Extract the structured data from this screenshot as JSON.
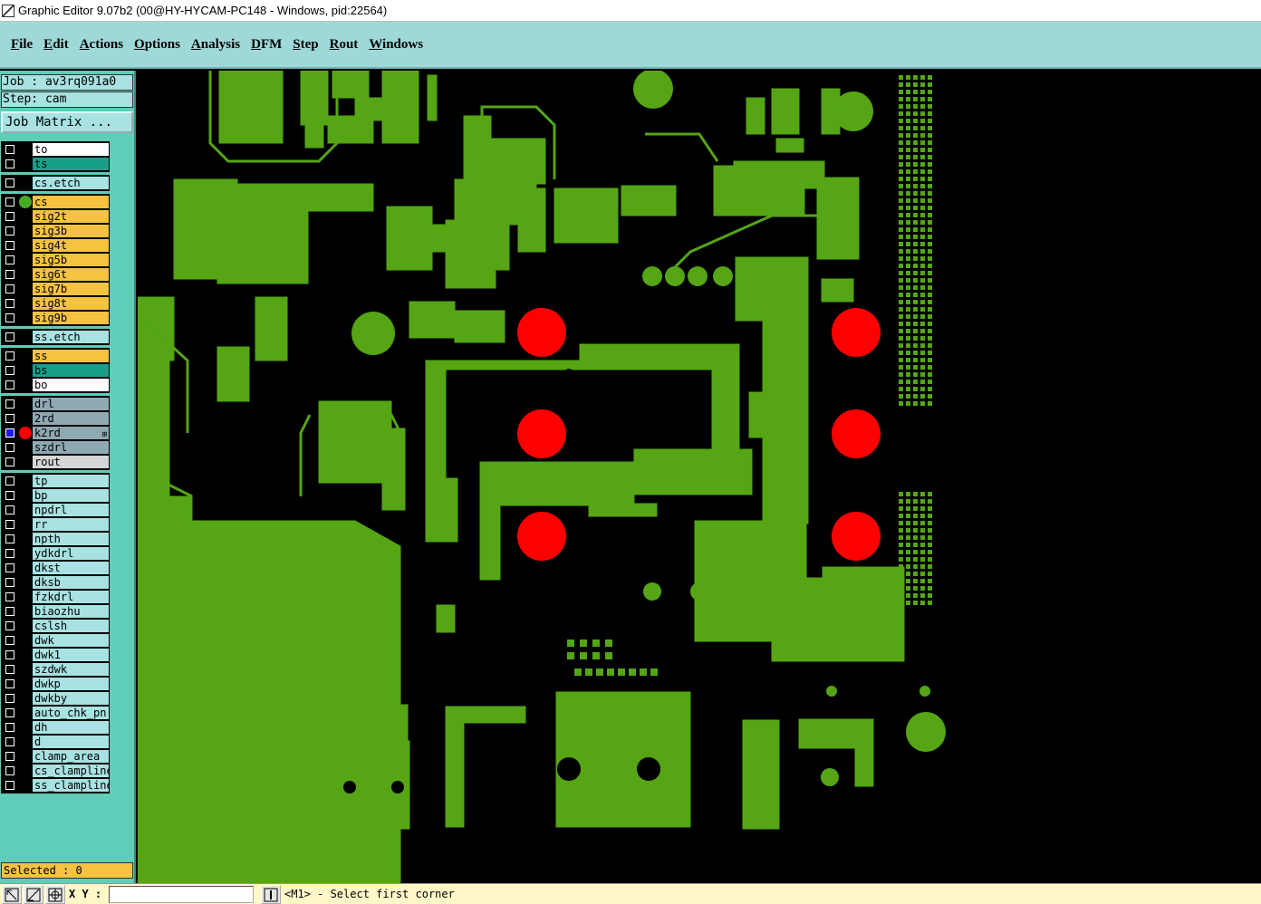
{
  "window": {
    "title": "Graphic Editor 9.07b2 (00@HY-HYCAM-PC148 - Windows, pid:22564)"
  },
  "menu": [
    "File",
    "Edit",
    "Actions",
    "Options",
    "Analysis",
    "DFM",
    "Step",
    "Rout",
    "Windows"
  ],
  "panel": {
    "job": "Job : av3rq091a0",
    "step": "Step: cam",
    "job_matrix_label": "Job Matrix ...",
    "selected": "Selected : 0"
  },
  "colors": {
    "board_green": "#55a514",
    "drill_red": "#ff0000",
    "layer_white": "#ffffff",
    "layer_teal": "#16a08a",
    "layer_cyan": "#a8e2e2",
    "layer_orange": "#f5c242",
    "layer_gray": "#8fa9b3",
    "layer_lightgray": "#d6d6d6"
  },
  "layer_groups": [
    {
      "layers": [
        {
          "name": "to",
          "color": "#ffffff"
        },
        {
          "name": "ts",
          "color": "#16a08a"
        }
      ]
    },
    {
      "layers": [
        {
          "name": "cs.etch",
          "color": "#a8e2e2"
        }
      ]
    },
    {
      "layers": [
        {
          "name": "cs",
          "color": "#f5c242",
          "visible_dot": "#44aa22"
        },
        {
          "name": "sig2t",
          "color": "#f5c242"
        },
        {
          "name": "sig3b",
          "color": "#f5c242"
        },
        {
          "name": "sig4t",
          "color": "#f5c242"
        },
        {
          "name": "sig5b",
          "color": "#f5c242"
        },
        {
          "name": "sig6t",
          "color": "#f5c242"
        },
        {
          "name": "sig7b",
          "color": "#f5c242"
        },
        {
          "name": "sig8t",
          "color": "#f5c242"
        },
        {
          "name": "sig9b",
          "color": "#f5c242"
        }
      ]
    },
    {
      "layers": [
        {
          "name": "ss.etch",
          "color": "#a8e2e2"
        }
      ]
    },
    {
      "layers": [
        {
          "name": "ss",
          "color": "#f5c242"
        },
        {
          "name": "bs",
          "color": "#16a08a"
        },
        {
          "name": "bo",
          "color": "#ffffff"
        }
      ]
    },
    {
      "layers": [
        {
          "name": "drl",
          "color": "#8fa9b3"
        },
        {
          "name": "2rd",
          "color": "#8fa9b3"
        },
        {
          "name": "k2rd",
          "color": "#8fa9b3",
          "visible_dot": "#ff0000",
          "work": true
        },
        {
          "name": "szdrl",
          "color": "#8fa9b3"
        },
        {
          "name": "rout",
          "color": "#d6d6d6"
        }
      ]
    },
    {
      "layers": [
        {
          "name": "tp",
          "color": "#a8e2e2"
        },
        {
          "name": "bp",
          "color": "#a8e2e2"
        },
        {
          "name": "npdrl",
          "color": "#a8e2e2"
        },
        {
          "name": "rr",
          "color": "#a8e2e2"
        },
        {
          "name": "npth",
          "color": "#a8e2e2"
        },
        {
          "name": "ydkdrl",
          "color": "#a8e2e2"
        },
        {
          "name": "dkst",
          "color": "#a8e2e2"
        },
        {
          "name": "dksb",
          "color": "#a8e2e2"
        },
        {
          "name": "fzkdrl",
          "color": "#a8e2e2"
        },
        {
          "name": "biaozhu",
          "color": "#a8e2e2"
        },
        {
          "name": "cslsh",
          "color": "#a8e2e2"
        },
        {
          "name": "dwk",
          "color": "#a8e2e2"
        },
        {
          "name": "dwk1",
          "color": "#a8e2e2"
        },
        {
          "name": "szdwk",
          "color": "#a8e2e2"
        },
        {
          "name": "dwkp",
          "color": "#a8e2e2"
        },
        {
          "name": "dwkby",
          "color": "#a8e2e2"
        },
        {
          "name": "auto_chk_pn",
          "color": "#a8e2e2"
        },
        {
          "name": "dh",
          "color": "#a8e2e2"
        },
        {
          "name": "d",
          "color": "#a8e2e2"
        },
        {
          "name": "clamp_area",
          "color": "#a8e2e2"
        },
        {
          "name": "cs_clampline",
          "color": "#a8e2e2"
        },
        {
          "name": "ss_clampline",
          "color": "#a8e2e2"
        }
      ]
    }
  ],
  "statusbar": {
    "xy_label": "X Y :",
    "xy_value": "",
    "message": "<M1> - Select first corner"
  }
}
